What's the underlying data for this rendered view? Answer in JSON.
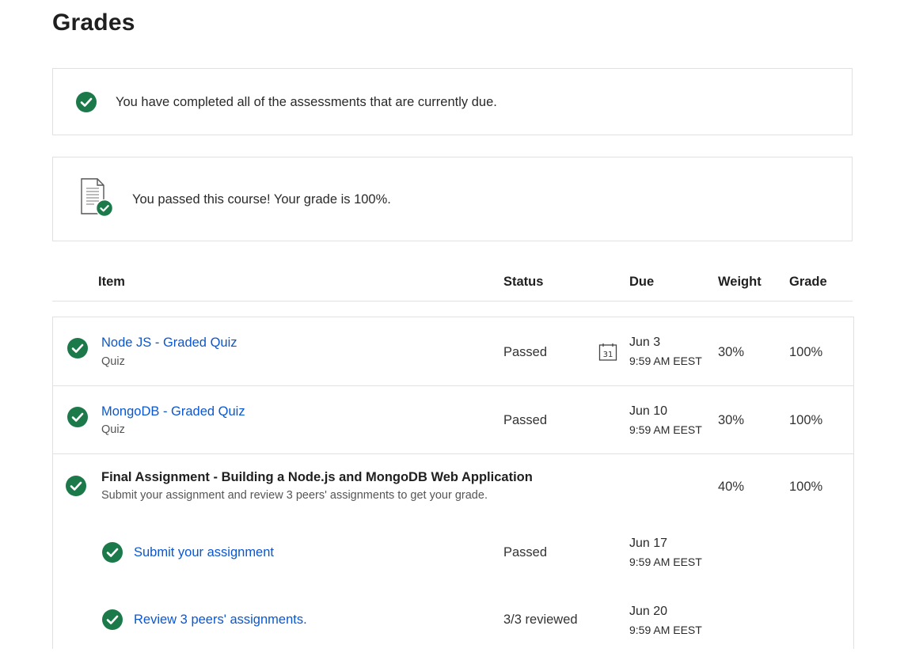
{
  "page": {
    "title": "Grades"
  },
  "alerts": {
    "due_message": "You have completed all of the assessments that are currently due.",
    "passed_message": "You passed this course! Your grade is 100%."
  },
  "table": {
    "headers": {
      "item": "Item",
      "status": "Status",
      "due": "Due",
      "weight": "Weight",
      "grade": "Grade"
    },
    "rows": [
      {
        "title": "Node JS - Graded Quiz",
        "type": "Quiz",
        "status": "Passed",
        "due_date": "Jun 3",
        "due_time": "9:59 AM EEST",
        "calendar_day": "31",
        "weight": "30%",
        "grade": "100%"
      },
      {
        "title": "MongoDB - Graded Quiz",
        "type": "Quiz",
        "status": "Passed",
        "due_date": "Jun 10",
        "due_time": "9:59 AM EEST",
        "weight": "30%",
        "grade": "100%"
      },
      {
        "title": "Final Assignment - Building a Node.js and MongoDB Web Application",
        "description": "Submit your assignment and review 3 peers' assignments to get your grade.",
        "weight": "40%",
        "grade": "100%",
        "subitems": [
          {
            "title": "Submit your assignment",
            "status": "Passed",
            "due_date": "Jun 17",
            "due_time": "9:59 AM EEST"
          },
          {
            "title": "Review 3 peers' assignments.",
            "status": "3/3 reviewed",
            "due_date": "Jun 20",
            "due_time": "9:59 AM EEST"
          }
        ]
      }
    ]
  },
  "icons": {
    "status_check": "check-circle-icon",
    "passed_document": "document-check-icon",
    "calendar": "calendar-icon"
  },
  "colors": {
    "success_green": "#1c7a4a",
    "link_blue": "#0a57d0",
    "border": "#e1e1e1"
  }
}
